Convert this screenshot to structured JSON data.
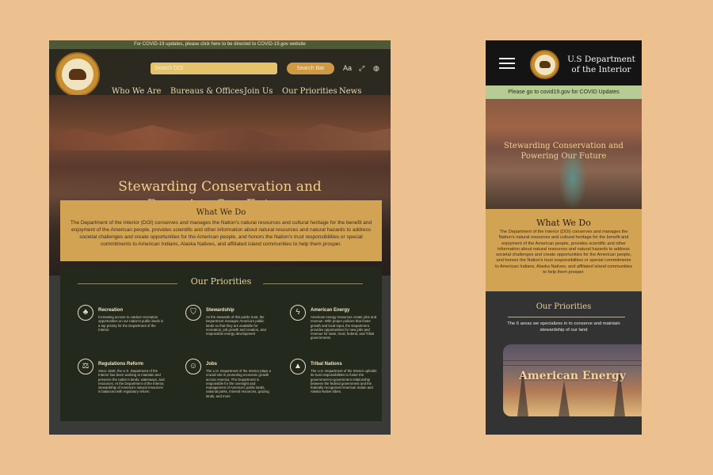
{
  "desktop": {
    "covid_banner": "For COVID-19 updates, please click here to be directed to COVID-19.gov website",
    "search": {
      "placeholder": "Search DOI",
      "button": "Search Bar"
    },
    "icons": {
      "text_size": "Aa"
    },
    "nav": [
      "Who We Are",
      "Bureaus & Offices",
      "Join Us",
      "Our Priorities",
      "News"
    ],
    "hero": {
      "line1": "Stewarding Conservation and",
      "line2": "Powering Our Future"
    },
    "what_we_do": {
      "title": "What We Do",
      "body": "The Department of the Interior (DOI) conserves and manages the Nation's natural resources and cultural heritage for the benefit and enjoyment of the American people, provides scientific and other information about natural resources and natural hazards to address societal challenges and create opportunities for the American people, and honors the Nation's trust responsibilities or special commitments to American Indians, Alaska Natives, and affiliated island communities to help them prosper."
    },
    "priorities": {
      "title": "Our Priorities",
      "items": [
        {
          "icon": "tree-icon",
          "title": "Recreation",
          "desc": "Increasing access to outdoor recreation opportunities on our nation's public lands is a top priority for the Department of the Interior."
        },
        {
          "icon": "shield-icon",
          "title": "Stewardship",
          "desc": "As the stewards of this public trust, the Department manages America's public lands so that they are available for recreation, job growth and creation, and responsible energy development"
        },
        {
          "icon": "lightning-icon",
          "title": "American Energy",
          "desc": "American energy resources create jobs and revenue. With proper policies that foster growth and local input, the Department provides opportunities for new jobs and revenue for state, local, federal, and Tribal governments."
        },
        {
          "icon": "scales-icon",
          "title": "Regulations Reform",
          "desc": "Since 1849, the U.S. Department of the Interior has been working to maintain and preserve the nation's lands, waterways, and resources. At the Department of the Interior, stewardship of America's natural resources is balanced with regulatory reform."
        },
        {
          "icon": "people-icon",
          "title": "Jobs",
          "desc": "The U.S. Department of the Interior plays a crucial role in promoting economic growth across America. The Department is responsible for the oversight and management of America's public lands, national parks, mineral resources, grazing lands, and more"
        },
        {
          "icon": "mountains-icon",
          "title": "Tribal Nations",
          "desc": "The U.S. Department of the Interior upholds its trust responsibilities to foster the government-to-government relationship between the federal government and the federally recognized American Indian and Alaska Native tribes."
        }
      ]
    }
  },
  "mobile": {
    "title_line1": "U.S Department",
    "title_line2": "of the Interior",
    "covid_banner": "Please go to covid19.gov for COVID Updates",
    "hero": {
      "line1": "Stewarding Conservation and",
      "line2": "Powering Our Future"
    },
    "what_we_do": {
      "title": "What We Do",
      "body": "The Department of the Interior (DOI) conserves and manages the Nation's natural resources and cultural heritage for the benefit and enjoyment of the American people, provides scientific and other information about natural resources and natural hazards to address societal challenges and create opportunities for the American people, and honors the Nation's trust responsibilities or special commitments to American Indians, Alaska Natives, and affiliated island communities to help them prosper."
    },
    "priorities": {
      "title": "Our Priorities",
      "subtitle": "The 6 areas we specializes in to conserve and maintain stewardship of our land",
      "card_label": "American Energy"
    }
  },
  "colors": {
    "background": "#ecc08f",
    "gold": "#d3a354",
    "dark_green": "#232a1d",
    "covid_green": "#b7cc94"
  }
}
